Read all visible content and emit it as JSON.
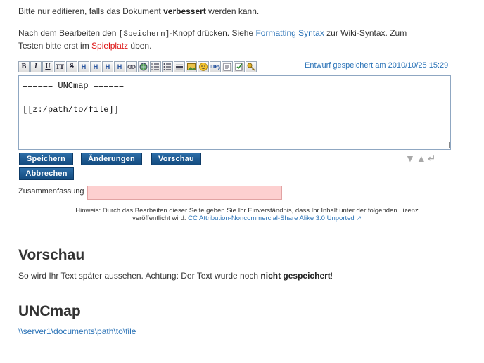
{
  "intro": {
    "line1_a": "Bitte nur editieren, falls das Dokument ",
    "line1_b": "verbessert",
    "line1_c": " werden kann.",
    "line2_a": "Nach dem Bearbeiten den ",
    "line2_code": "[Speichern]",
    "line2_b": "-Knopf drücken. Siehe ",
    "line2_link": "Formatting Syntax",
    "line2_c": " zur Wiki-Syntax. Zum",
    "line3_a": "Testen bitte erst im ",
    "line3_link": "Spielplatz",
    "line3_b": " üben."
  },
  "toolbar": {
    "buttons": [
      "B",
      "I",
      "U",
      "TT",
      "S",
      "H",
      "H",
      "H",
      "H",
      "link",
      "extlink",
      "ol",
      "ul",
      "hr",
      "image",
      "smiley",
      "omega",
      "special",
      "signature",
      "key"
    ],
    "draft_text": "Entwurf gespeichert am 2010/10/25 15:29"
  },
  "editor": {
    "content": "====== UNCmap ======\n\n[[z:/path/to/file]]"
  },
  "buttons": {
    "save": "Speichern",
    "changes": "Änderungen",
    "preview": "Vorschau",
    "cancel": "Abbrechen"
  },
  "summary": {
    "label": "Zusammenfassung",
    "value": ""
  },
  "license": {
    "line1": "Hinweis: Durch das Bearbeiten dieser Seite geben Sie Ihr Einverständnis, dass Ihr Inhalt unter der folgenden Lizenz",
    "line2_a": "veröffentlicht wird: ",
    "link": "CC Attribution-Noncommercial-Share Alike 3.0 Unported"
  },
  "preview": {
    "heading": "Vorschau",
    "text_a": "So wird Ihr Text später aussehen. Achtung: Der Text wurde noch ",
    "text_b": "nicht gespeichert",
    "text_c": "!"
  },
  "page": {
    "heading": "UNCmap",
    "unc_link": "\\\\server1\\documents\\path\\to\\file"
  },
  "colors": {
    "link": "#2b73b7",
    "button": "#1b5b95",
    "summary_bg": "#fdd0d0"
  }
}
